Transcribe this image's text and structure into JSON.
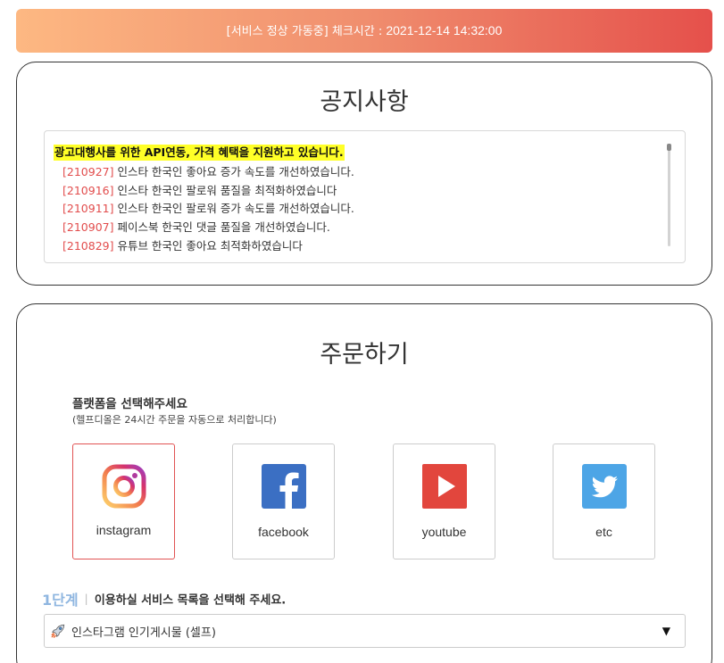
{
  "status": {
    "text": "[서비스 정상 가동중] 체크시간 : ",
    "time": "2021-12-14 14:32:00"
  },
  "notice": {
    "title": "공지사항",
    "headline": "광고대행사를 위한 API연동, 가격 혜택을 지원하고 있습니다.",
    "items": [
      {
        "code": "[210927]",
        "text": " 인스타 한국인 좋아요 증가 속도를 개선하였습니다."
      },
      {
        "code": "[210916]",
        "text": " 인스타 한국인 팔로워 품질을 최적화하였습니다"
      },
      {
        "code": "[210911]",
        "text": " 인스타 한국인 팔로워 증가 속도를 개선하였습니다."
      },
      {
        "code": "[210907]",
        "text": " 페이스북 한국인 댓글 품질을 개선하였습니다."
      },
      {
        "code": "[210829]",
        "text": " 유튜브 한국인 좋아요 최적화하였습니다"
      }
    ]
  },
  "order": {
    "title": "주문하기",
    "platform_heading": "플랫폼을 선택해주세요",
    "platform_sub": "(헬프디올은 24시간 주문을 자동으로 처리합니다)",
    "platforms": [
      {
        "label": "instagram",
        "icon": "instagram-icon"
      },
      {
        "label": "facebook",
        "icon": "facebook-icon"
      },
      {
        "label": "youtube",
        "icon": "youtube-icon"
      },
      {
        "label": "etc",
        "icon": "twitter-icon"
      }
    ],
    "step": {
      "number": "1단계",
      "separator": "|",
      "text": "이용하실 서비스 목록을 선택해 주세요."
    },
    "service_select": {
      "value": "인스타그램 인기게시물 (셀프)",
      "icon": "rocket-icon"
    }
  },
  "colors": {
    "gradient_start": "#fdb882",
    "gradient_end": "#e5504b",
    "highlight": "#ffff27",
    "notice_code": "#e24d4d",
    "selected_border": "#e15353",
    "step_number": "#8fb6e0",
    "facebook": "#3b6fc3",
    "youtube": "#e2463d",
    "twitter": "#4da5e6"
  }
}
